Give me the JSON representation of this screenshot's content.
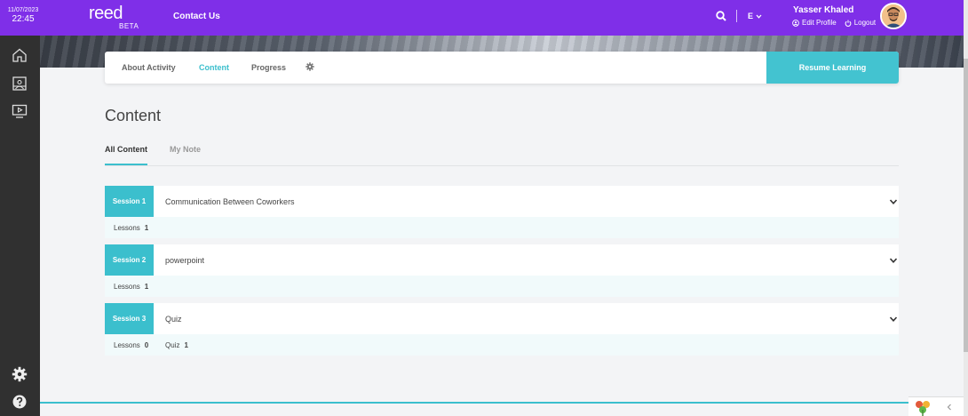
{
  "header": {
    "date": "11/07/2023",
    "time": "22:45",
    "logo": "reed",
    "logo_sub": "BETA",
    "contact_label": "Contact Us",
    "lang_label": "E",
    "user_name": "Yasser Khaled",
    "edit_profile_label": "Edit Profile",
    "logout_label": "Logout",
    "accent_color": "#7f2fe8"
  },
  "sidebar": {
    "items": [
      "home-icon",
      "courses-icon",
      "video-icon"
    ],
    "bottom_items": [
      "settings-icon",
      "help-icon"
    ]
  },
  "tabs": {
    "items": [
      "About Activity",
      "Content",
      "Progress"
    ],
    "active": "Content",
    "resume_label": "Resume Learning"
  },
  "page": {
    "title": "Content",
    "subtabs": [
      "All Content",
      "My Note"
    ],
    "active_subtab": "All Content"
  },
  "sessions": [
    {
      "badge": "Session 1",
      "title": "Communication Between Coworkers",
      "lessons_label": "Lessons",
      "lessons_count": "1"
    },
    {
      "badge": "Session 2",
      "title": "powerpoint",
      "lessons_label": "Lessons",
      "lessons_count": "1"
    },
    {
      "badge": "Session 3",
      "title": "Quiz",
      "lessons_label": "Lessons",
      "lessons_count": "0",
      "quiz_label": "Quiz",
      "quiz_count": "1"
    }
  ]
}
